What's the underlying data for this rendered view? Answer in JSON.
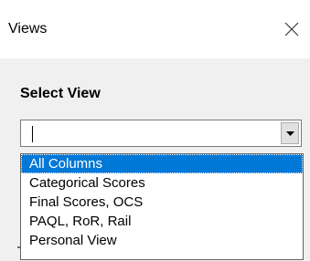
{
  "window": {
    "title": "Views",
    "close_icon": "close-icon"
  },
  "form": {
    "label": "Select View",
    "combo_value": "",
    "combo_arrow_icon": "dropdown-arrow-icon"
  },
  "dropdown": {
    "items": [
      {
        "label": "All Columns",
        "selected": true
      },
      {
        "label": "Categorical Scores",
        "selected": false
      },
      {
        "label": "Final Scores, OCS",
        "selected": false
      },
      {
        "label": "PAQL, RoR, Rail",
        "selected": false
      },
      {
        "label": "Personal View",
        "selected": false
      }
    ]
  },
  "colors": {
    "selection": "#0078d7",
    "dialog_background": "#f0f0f0",
    "titlebar_background": "#ffffff"
  }
}
